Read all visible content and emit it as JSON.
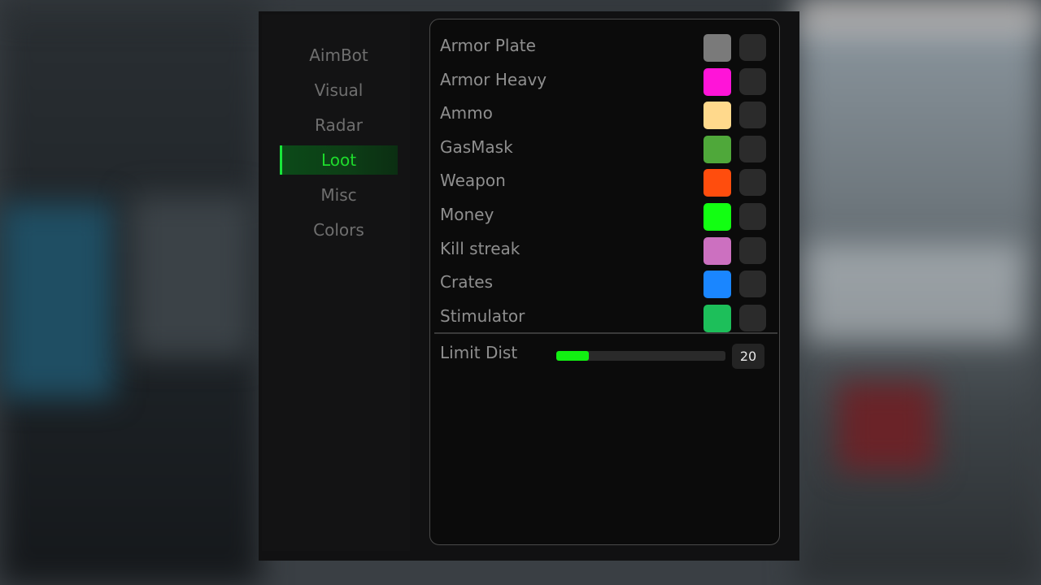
{
  "nav": {
    "items": [
      {
        "label": "AimBot",
        "active": false
      },
      {
        "label": "Visual",
        "active": false
      },
      {
        "label": "Radar",
        "active": false
      },
      {
        "label": "Loot",
        "active": true
      },
      {
        "label": "Misc",
        "active": false
      },
      {
        "label": "Colors",
        "active": false
      }
    ]
  },
  "loot": {
    "items": [
      {
        "label": "Armor Plate",
        "color": "#7a7a7a"
      },
      {
        "label": "Armor Heavy",
        "color": "#ff14d8"
      },
      {
        "label": "Ammo",
        "color": "#ffd98c"
      },
      {
        "label": "GasMask",
        "color": "#4fa83a"
      },
      {
        "label": "Weapon",
        "color": "#ff4d0d"
      },
      {
        "label": "Money",
        "color": "#12ff12"
      },
      {
        "label": "Kill streak",
        "color": "#cc70c0"
      },
      {
        "label": "Crates",
        "color": "#1a86ff"
      },
      {
        "label": "Stimulator",
        "color": "#1dbf5a"
      }
    ],
    "limit_dist": {
      "label": "Limit Dist",
      "value": "20",
      "fill_fraction": 0.19
    }
  },
  "colors": {
    "accent": "#1edc2c",
    "slider_fill": "#12f012"
  }
}
